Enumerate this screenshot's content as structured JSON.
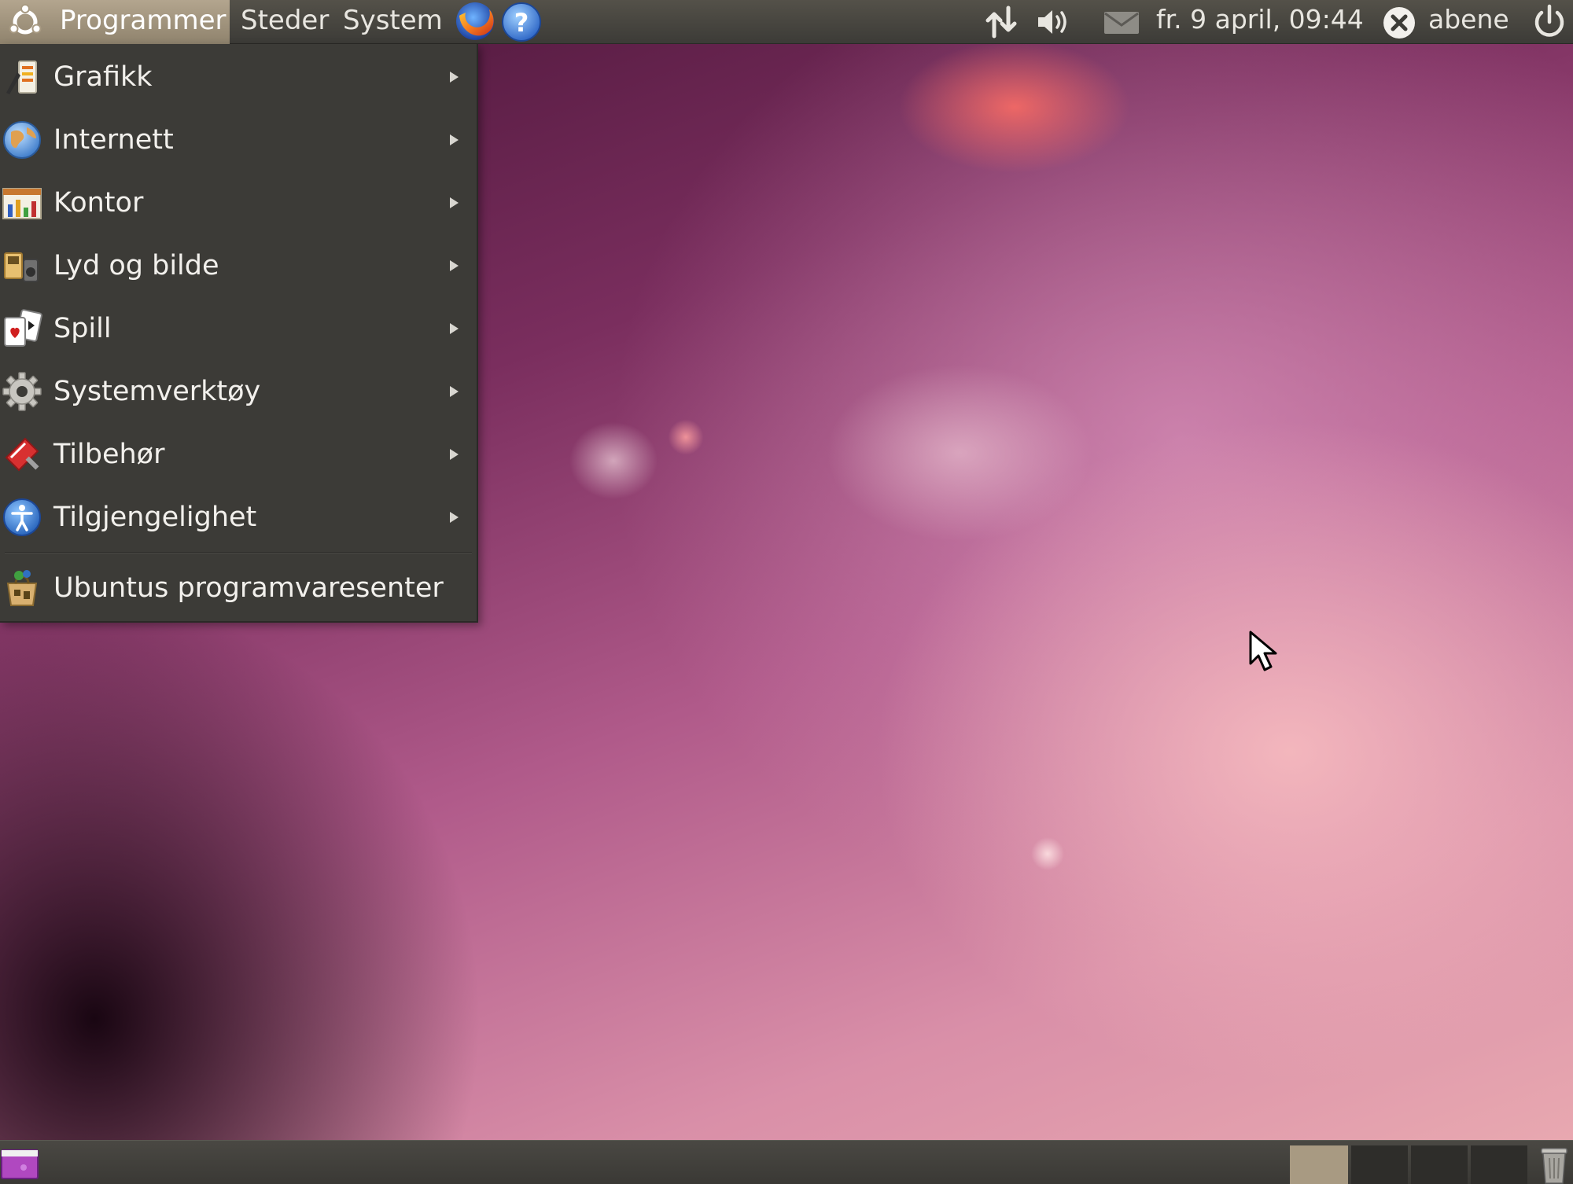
{
  "top_panel": {
    "menus": {
      "programs": "Programmer",
      "places": "Steder",
      "system": "System"
    },
    "launchers": {
      "browser_icon": "firefox-icon",
      "help_icon": "help-icon"
    },
    "tray": {
      "network_icon": "network-icon",
      "volume_icon": "volume-icon",
      "mail_icon": "mail-icon",
      "clock": "fr.  9 april, 09:44",
      "status_icon": "user-status-icon",
      "username": "abene",
      "power_icon": "power-icon"
    }
  },
  "programs_menu": {
    "items": [
      {
        "label": "Grafikk",
        "icon": "graphics-icon",
        "submenu": true
      },
      {
        "label": "Internett",
        "icon": "globe-icon",
        "submenu": true
      },
      {
        "label": "Kontor",
        "icon": "office-icon",
        "submenu": true
      },
      {
        "label": "Lyd og bilde",
        "icon": "multimedia-icon",
        "submenu": true
      },
      {
        "label": "Spill",
        "icon": "cards-icon",
        "submenu": true
      },
      {
        "label": "Systemverktøy",
        "icon": "gear-icon",
        "submenu": true
      },
      {
        "label": "Tilbehør",
        "icon": "accessories-icon",
        "submenu": true
      },
      {
        "label": "Tilgjengelighet",
        "icon": "accessibility-icon",
        "submenu": true
      },
      {
        "label": "Ubuntus programvaresenter",
        "icon": "software-center-icon",
        "submenu": false
      }
    ]
  },
  "bottom_panel": {
    "show_desktop_icon": "show-desktop-icon",
    "trash_icon": "trash-icon",
    "workspaces": 4,
    "active_workspace": 1
  },
  "colors": {
    "panel": "#3c3b37",
    "menu_bg": "#3c3b37",
    "active_menu": "#a89a82",
    "wallpaper_accent": "#b05a8a"
  }
}
